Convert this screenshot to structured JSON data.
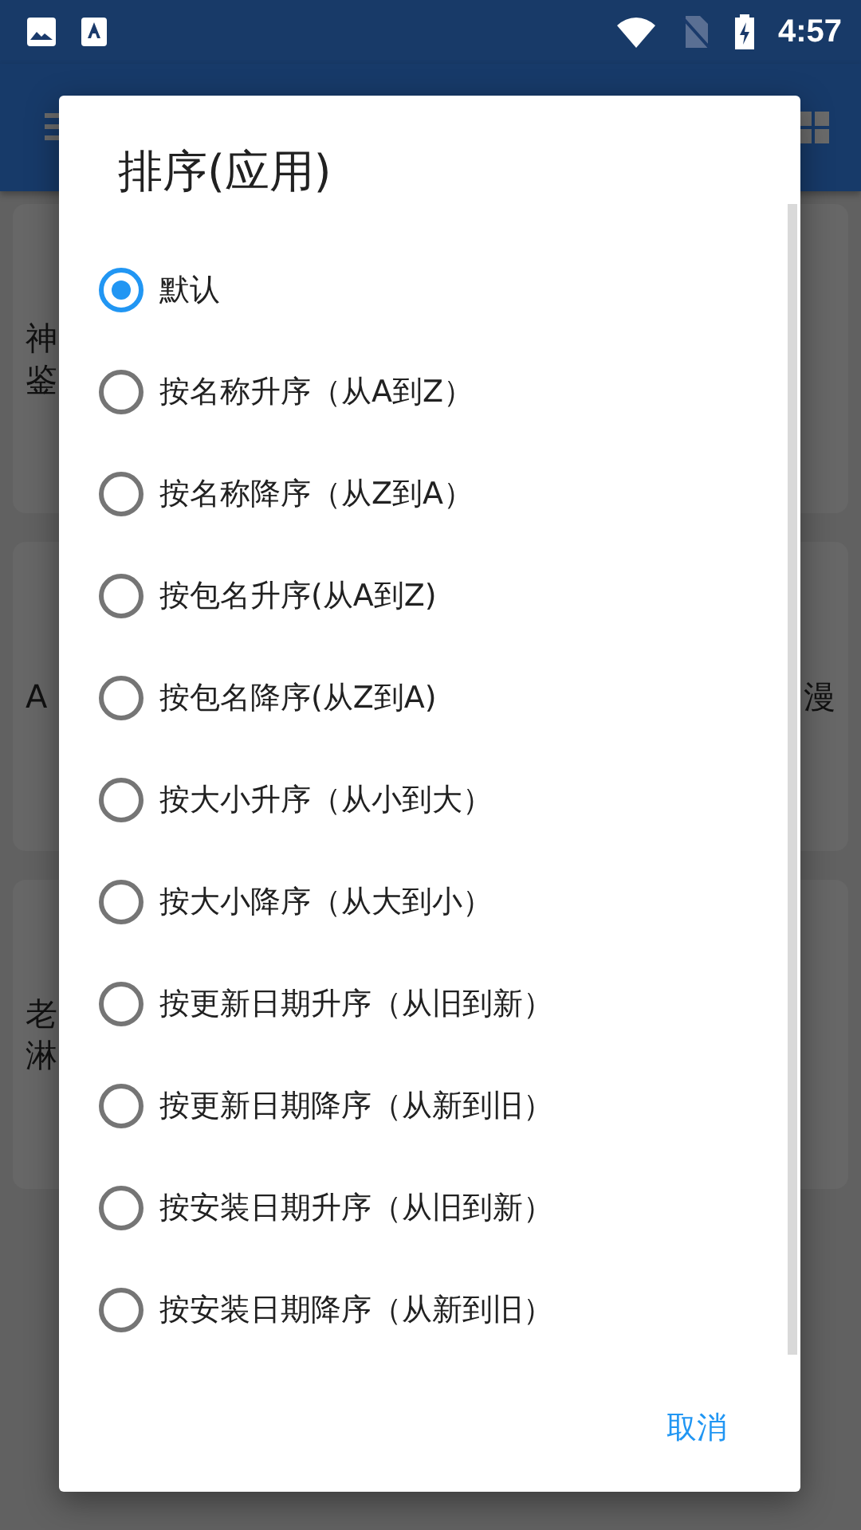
{
  "status_bar": {
    "time": "4:57"
  },
  "background_rows": [
    {
      "left": [
        "神",
        "鉴"
      ]
    },
    {
      "left": [
        "A"
      ],
      "right": [
        "漫"
      ]
    },
    {
      "left": [
        "老",
        "淋"
      ]
    }
  ],
  "dialog": {
    "title": "排序(应用)",
    "options": [
      {
        "label": "默认",
        "selected": true
      },
      {
        "label": "按名称升序（从A到Z）",
        "selected": false
      },
      {
        "label": "按名称降序（从Z到A）",
        "selected": false
      },
      {
        "label": "按包名升序(从A到Z)",
        "selected": false
      },
      {
        "label": "按包名降序(从Z到A)",
        "selected": false
      },
      {
        "label": "按大小升序（从小到大）",
        "selected": false
      },
      {
        "label": "按大小降序（从大到小）",
        "selected": false
      },
      {
        "label": "按更新日期升序（从旧到新）",
        "selected": false
      },
      {
        "label": "按更新日期降序（从新到旧）",
        "selected": false
      },
      {
        "label": "按安装日期升序（从旧到新）",
        "selected": false
      },
      {
        "label": "按安装日期降序（从新到旧）",
        "selected": false
      }
    ],
    "cancel_button": "取消"
  }
}
